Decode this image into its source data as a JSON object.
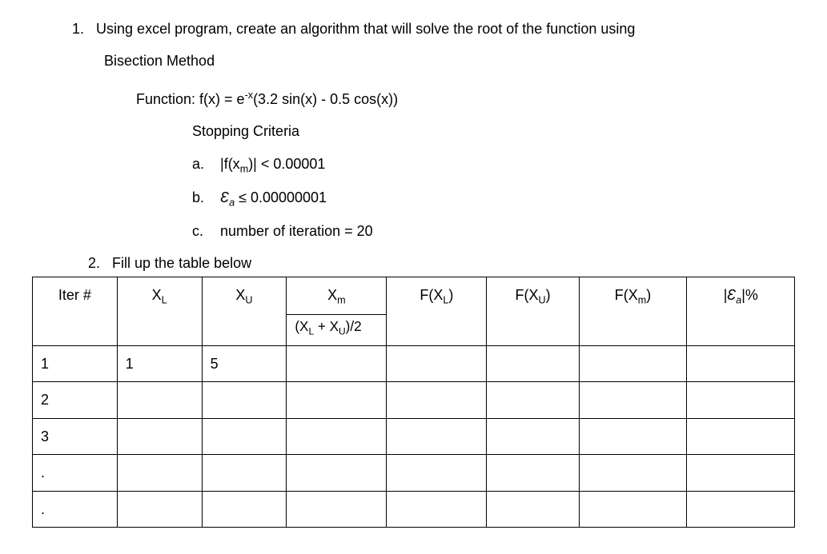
{
  "problem1": {
    "number": "1.",
    "text_line1": "Using excel program, create an algorithm that will solve the root of the function using",
    "text_line2": "Bisection Method"
  },
  "function": {
    "label": "Function: f(x) = e",
    "exp": "-x",
    "rest": "(3.2 sin(x) - 0.5 cos(x))"
  },
  "stopping_criteria_label": "Stopping Criteria",
  "criteria": {
    "a": {
      "letter": "a.",
      "text_pre": "|f(x",
      "text_sub": "m",
      "text_post": ")| < 0.00001"
    },
    "b": {
      "letter": "b.",
      "text_pre": "Ɛ",
      "text_sub": "a",
      "text_post": "  ≤ 0.00000001"
    },
    "c": {
      "letter": "c.",
      "text": "number of iteration = 20"
    }
  },
  "problem2": {
    "number": "2.",
    "text": "Fill up the table below"
  },
  "table": {
    "headers": {
      "iter": "Iter #",
      "xl_main": "X",
      "xl_sub": "L",
      "xu_main": "X",
      "xu_sub": "U",
      "xm_main": "X",
      "xm_sub": "m",
      "xm_formula_pre": "(X",
      "xm_formula_sub1": "L",
      "xm_formula_mid": " + X",
      "xm_formula_sub2": "U",
      "xm_formula_post": ")/2",
      "fxl_pre": "F(X",
      "fxl_sub": "L",
      "fxl_post": ")",
      "fxu_pre": "F(X",
      "fxu_sub": "U",
      "fxu_post": ")",
      "fxm_pre": "F(X",
      "fxm_sub": "m",
      "fxm_post": ")",
      "ea_pre": "|Ɛ",
      "ea_sub": "a",
      "ea_post": "|%"
    },
    "rows": [
      {
        "iter": "1",
        "xl": "1",
        "xu": "5",
        "xm": "",
        "fxl": "",
        "fxu": "",
        "fxm": "",
        "ea": ""
      },
      {
        "iter": "2",
        "xl": "",
        "xu": "",
        "xm": "",
        "fxl": "",
        "fxu": "",
        "fxm": "",
        "ea": ""
      },
      {
        "iter": "3",
        "xl": "",
        "xu": "",
        "xm": "",
        "fxl": "",
        "fxu": "",
        "fxm": "",
        "ea": ""
      },
      {
        "iter": ".",
        "xl": "",
        "xu": "",
        "xm": "",
        "fxl": "",
        "fxu": "",
        "fxm": "",
        "ea": ""
      },
      {
        "iter": ".",
        "xl": "",
        "xu": "",
        "xm": "",
        "fxl": "",
        "fxu": "",
        "fxm": "",
        "ea": ""
      }
    ]
  }
}
